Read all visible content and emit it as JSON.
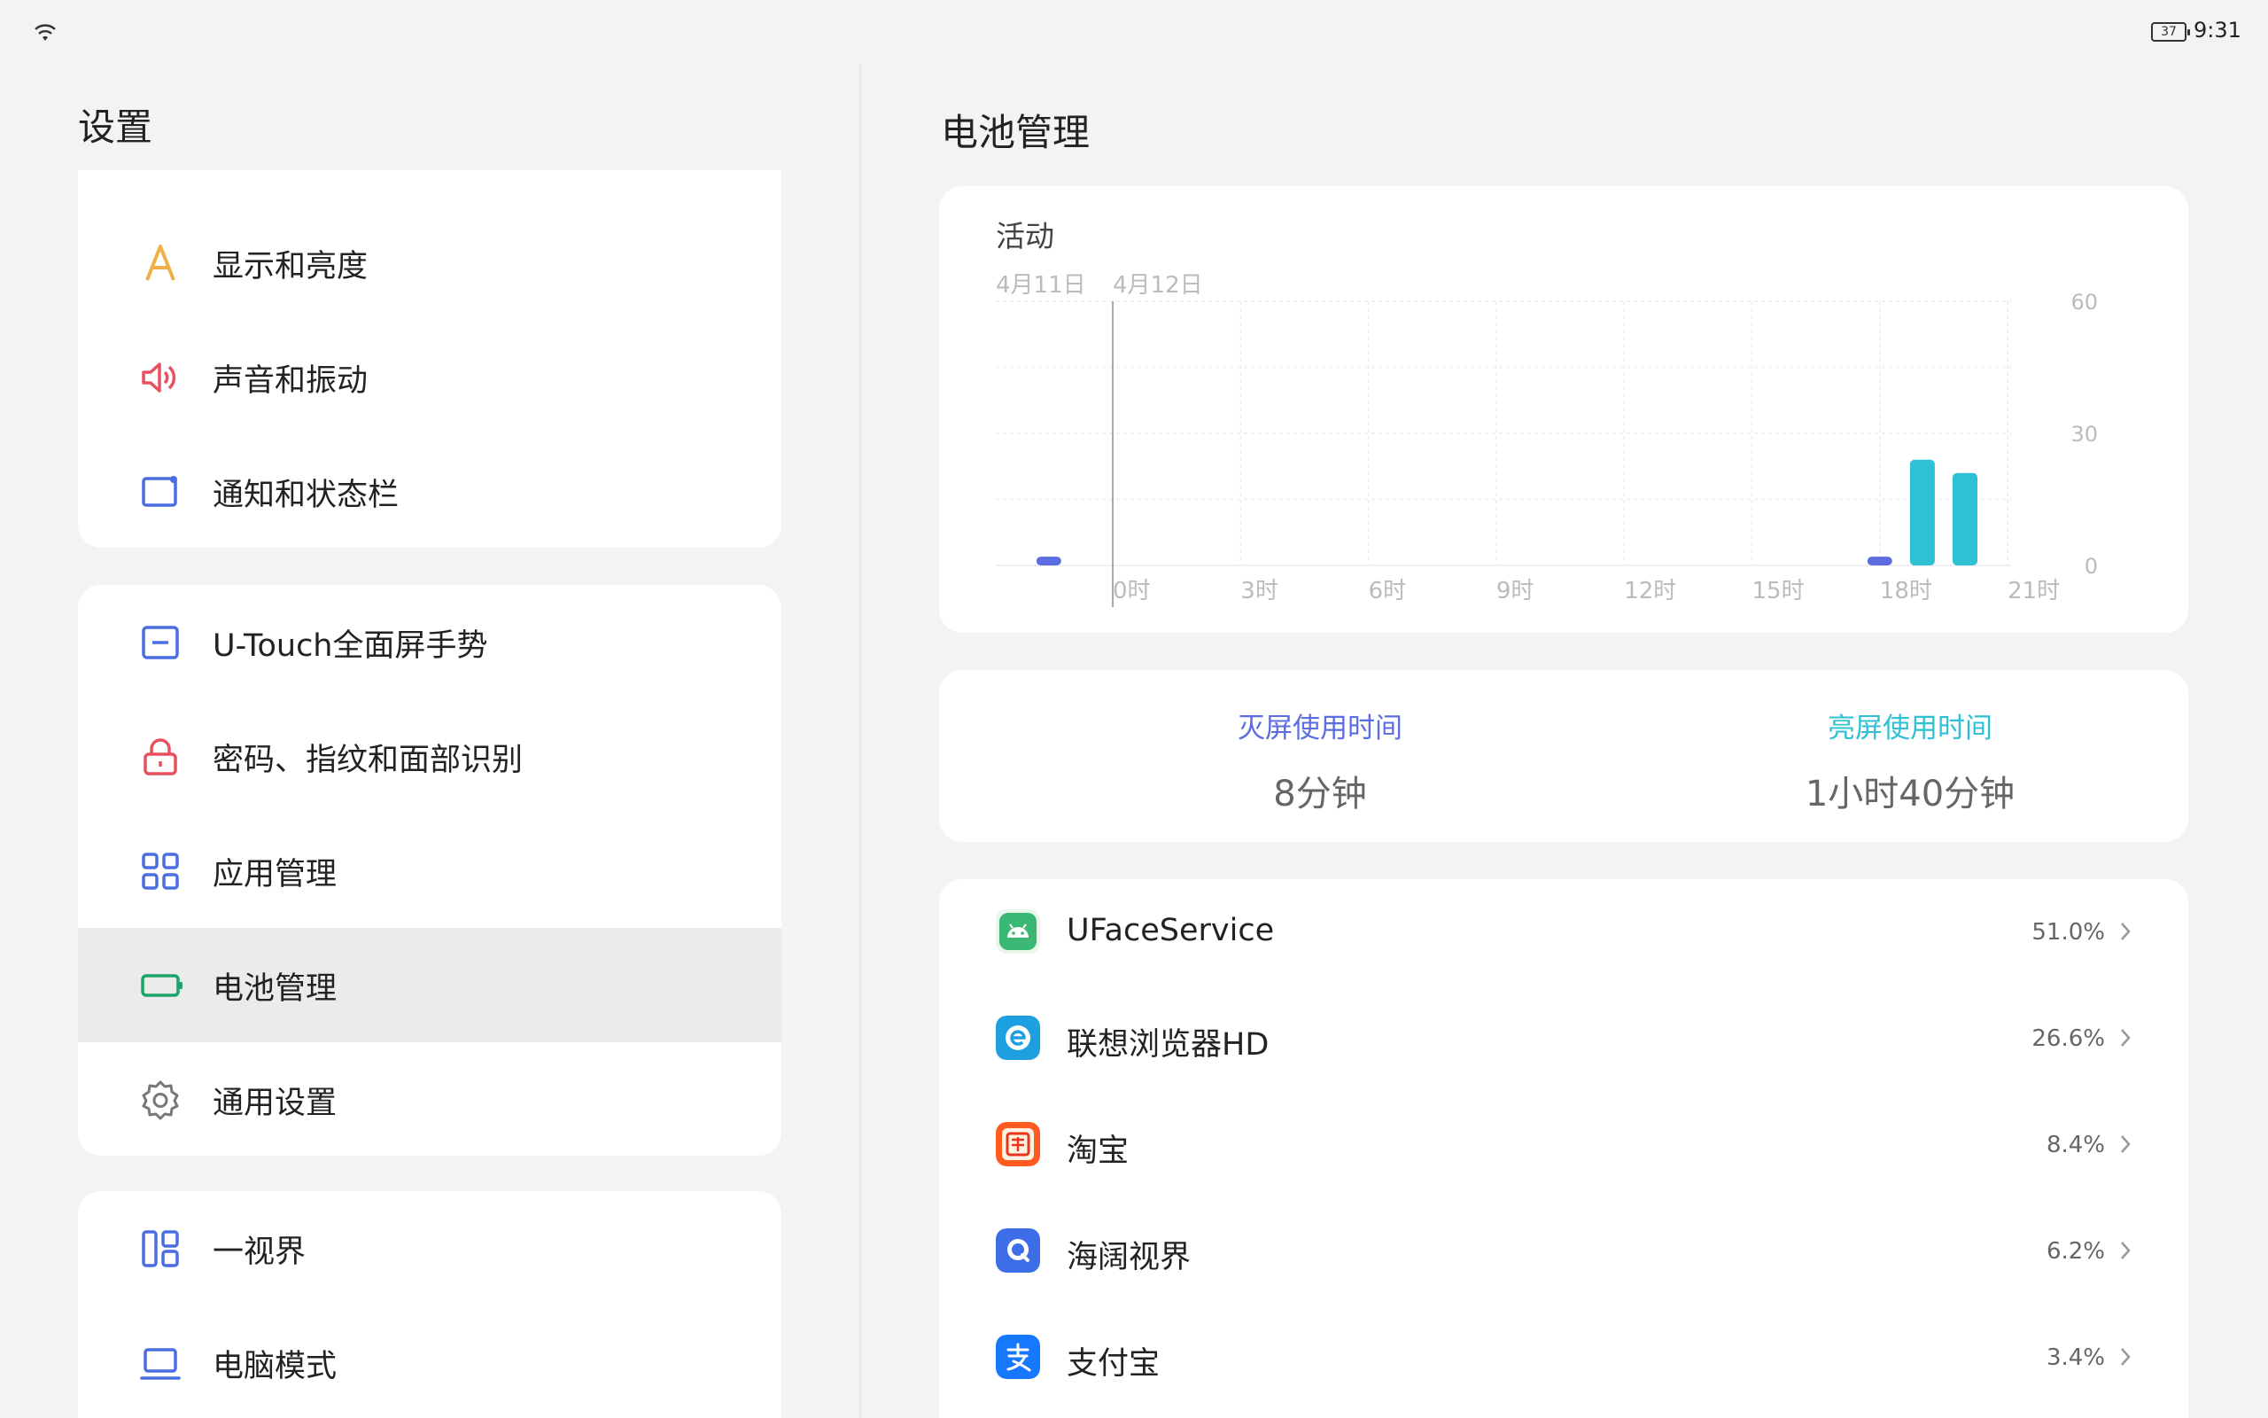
{
  "status": {
    "battery": "37",
    "time": "9:31"
  },
  "left": {
    "title": "设置",
    "groups": [
      {
        "items": [
          {
            "label": "显示和亮度",
            "icon": "display-brightness-icon",
            "color": "#f0b048"
          },
          {
            "label": "声音和振动",
            "icon": "speaker-icon",
            "color": "#e85060"
          },
          {
            "label": "通知和状态栏",
            "icon": "notification-icon",
            "color": "#4a6ee0"
          }
        ]
      },
      {
        "items": [
          {
            "label": "U-Touch全面屏手势",
            "icon": "gesture-icon",
            "color": "#4a6ee0"
          },
          {
            "label": "密码、指纹和面部识别",
            "icon": "lock-icon",
            "color": "#e85060"
          },
          {
            "label": "应用管理",
            "icon": "apps-grid-icon",
            "color": "#4a6ee0"
          },
          {
            "label": "电池管理",
            "icon": "battery-icon",
            "color": "#1aa66b",
            "selected": true
          },
          {
            "label": "通用设置",
            "icon": "gear-icon",
            "color": "#777777"
          }
        ]
      },
      {
        "items": [
          {
            "label": "一视界",
            "icon": "layout-icon",
            "color": "#4a6ee0"
          },
          {
            "label": "电脑模式",
            "icon": "laptop-icon",
            "color": "#4a6ee0"
          }
        ]
      }
    ]
  },
  "right": {
    "title": "电池管理",
    "chart_label": "活动",
    "usage": {
      "screen_off_label": "灭屏使用时间",
      "screen_off_value": "8分钟",
      "screen_on_label": "亮屏使用时间",
      "screen_on_value": "1小时40分钟",
      "screen_off_color": "#5b6de0",
      "screen_on_color": "#2ec0d4"
    },
    "apps": [
      {
        "name": "UFaceService",
        "percent": "51.0%",
        "icon": "android-app-icon"
      },
      {
        "name": "联想浏览器HD",
        "percent": "26.6%",
        "icon": "browser-app-icon"
      },
      {
        "name": "淘宝",
        "percent": "8.4%",
        "icon": "taobao-app-icon"
      },
      {
        "name": "海阔视界",
        "percent": "6.2%",
        "icon": "haikuo-app-icon"
      },
      {
        "name": "支付宝",
        "percent": "3.4%",
        "icon": "alipay-app-icon"
      }
    ]
  },
  "chart_data": {
    "type": "bar",
    "date_labels": [
      "4月11日",
      "4月12日"
    ],
    "x_tick_labels": [
      "0时",
      "3时",
      "6时",
      "9时",
      "12时",
      "15时",
      "18时",
      "21时"
    ],
    "y_tick_labels": [
      "60",
      "30",
      "0"
    ],
    "ylim": [
      0,
      60
    ],
    "xlim": [
      -3,
      21
    ],
    "series": [
      {
        "color": "#5b6de0",
        "points": [
          {
            "x": -1.5,
            "y": 2
          },
          {
            "x": 18,
            "y": 2
          }
        ]
      },
      {
        "color": "#2ec0d4",
        "points": [
          {
            "x": 19,
            "y": 24
          },
          {
            "x": 20,
            "y": 21
          }
        ]
      }
    ]
  }
}
